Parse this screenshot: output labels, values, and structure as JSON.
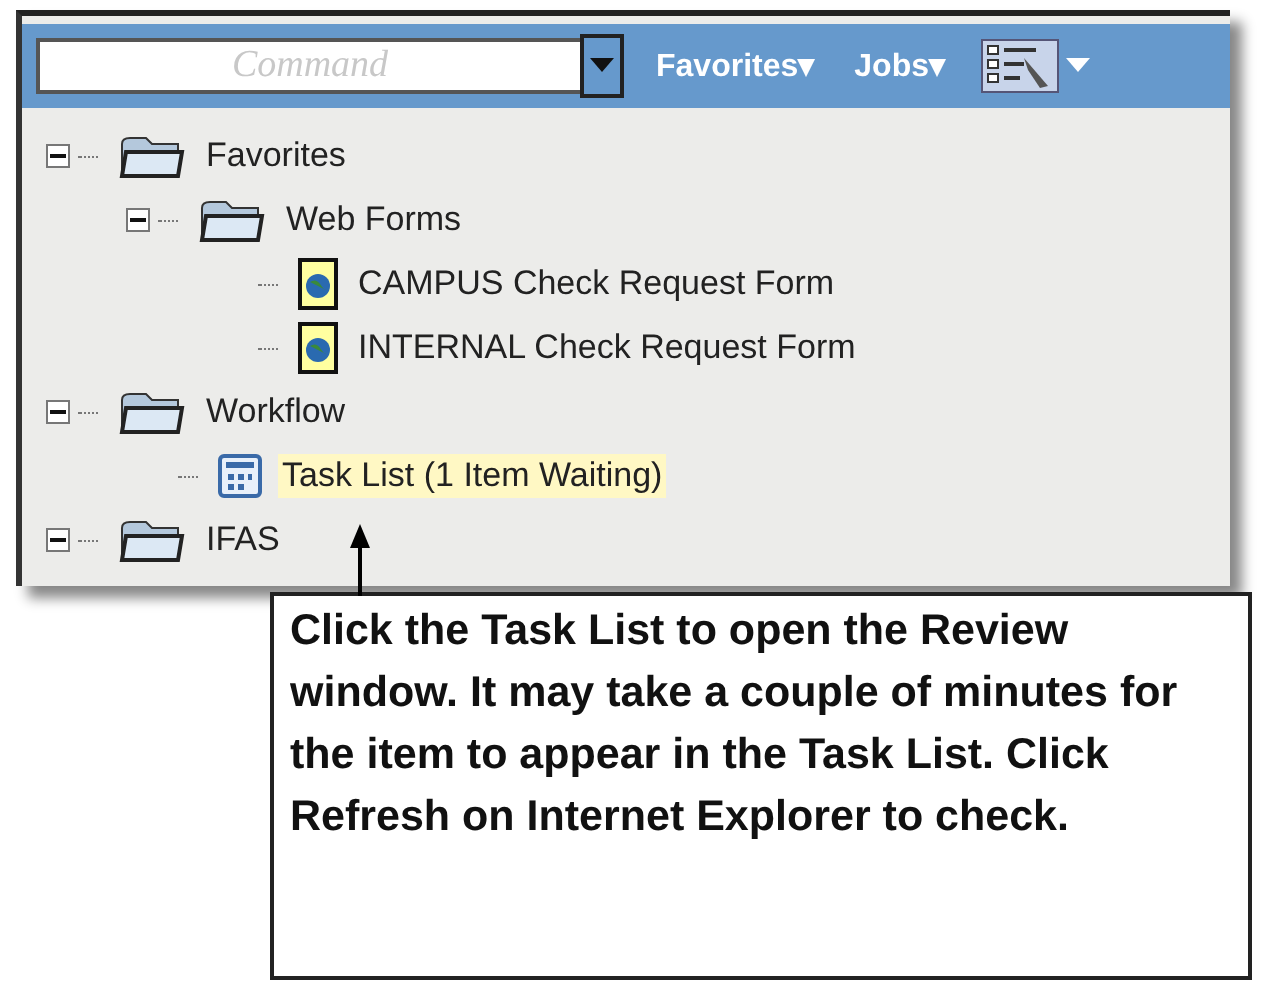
{
  "toolbar": {
    "command_field": {
      "placeholder": "Command"
    },
    "menus": [
      {
        "label": "Favorites▾"
      },
      {
        "label": "Jobs▾"
      }
    ]
  },
  "tree": [
    {
      "label": "Favorites",
      "kind": "folder",
      "expanded": true,
      "selected": false,
      "children": [
        {
          "label": "Web Forms",
          "kind": "folder",
          "expanded": true,
          "selected": false,
          "children": [
            {
              "label": "CAMPUS Check Request Form",
              "kind": "form",
              "selected": false
            },
            {
              "label": "INTERNAL Check Request Form",
              "kind": "form",
              "selected": false
            }
          ]
        }
      ]
    },
    {
      "label": "Workflow",
      "kind": "folder",
      "expanded": true,
      "selected": false,
      "children": [
        {
          "label": "Task List (1 Item Waiting)",
          "kind": "task",
          "selected": true
        }
      ]
    },
    {
      "label": "IFAS",
      "kind": "folder",
      "expanded": true,
      "selected": false
    }
  ],
  "callout": {
    "text": "Click the Task List to open the Review window. It may take a couple of minutes for the item to appear in the Task List. Click Refresh on Internet Explorer to check."
  }
}
